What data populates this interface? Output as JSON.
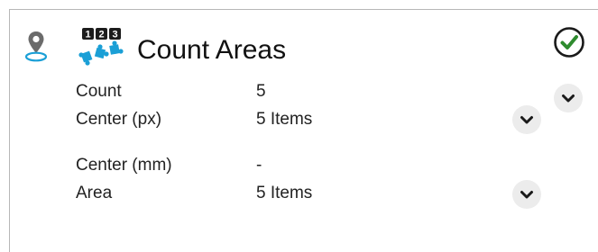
{
  "header": {
    "title": "Count Areas",
    "pin_icon": "map-pin-icon",
    "app_icon": "count-puzzle-icon",
    "app_icon_digits": "123",
    "status_icon": "check-circle-icon",
    "accent_color": "#1a9fd6",
    "status_color": "#2e8b2e"
  },
  "rows": [
    {
      "label": "Count",
      "value": "5"
    },
    {
      "label": "Center (px)",
      "value": "5 Items"
    },
    {
      "label": "Center (mm)",
      "value": "-"
    },
    {
      "label": "Area",
      "value": "5 Items"
    }
  ],
  "buttons": {
    "collapse_icon": "chevron-down-icon"
  }
}
